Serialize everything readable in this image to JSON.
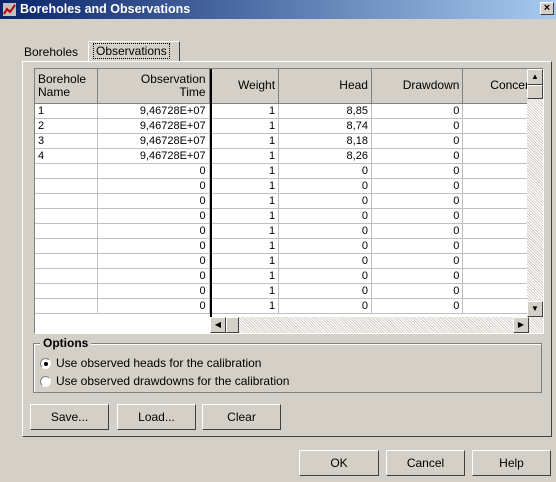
{
  "window": {
    "title": "Boreholes and Observations",
    "close_glyph": "×"
  },
  "tabs": [
    {
      "label": "Boreholes"
    },
    {
      "label": "Observations"
    }
  ],
  "grid": {
    "columns": [
      {
        "line1": "Borehole",
        "line2": "Name"
      },
      {
        "line1": "Observation",
        "line2": "Time"
      },
      {
        "line1": "Weight",
        "line2": ""
      },
      {
        "line1": "Head",
        "line2": ""
      },
      {
        "line1": "Drawdown",
        "line2": ""
      },
      {
        "line1": "Concentr",
        "line2": ""
      }
    ],
    "rows": [
      [
        "1",
        "9,46728E+07",
        "1",
        "8,85",
        "0",
        ""
      ],
      [
        "2",
        "9,46728E+07",
        "1",
        "8,74",
        "0",
        ""
      ],
      [
        "3",
        "9,46728E+07",
        "1",
        "8,18",
        "0",
        ""
      ],
      [
        "4",
        "9,46728E+07",
        "1",
        "8,26",
        "0",
        ""
      ],
      [
        "",
        "0",
        "1",
        "0",
        "0",
        ""
      ],
      [
        "",
        "0",
        "1",
        "0",
        "0",
        ""
      ],
      [
        "",
        "0",
        "1",
        "0",
        "0",
        ""
      ],
      [
        "",
        "0",
        "1",
        "0",
        "0",
        ""
      ],
      [
        "",
        "0",
        "1",
        "0",
        "0",
        ""
      ],
      [
        "",
        "0",
        "1",
        "0",
        "0",
        ""
      ],
      [
        "",
        "0",
        "1",
        "0",
        "0",
        ""
      ],
      [
        "",
        "0",
        "1",
        "0",
        "0",
        ""
      ],
      [
        "",
        "0",
        "1",
        "0",
        "0",
        ""
      ],
      [
        "",
        "0",
        "1",
        "0",
        "0",
        ""
      ]
    ]
  },
  "options": {
    "legend": "Options",
    "heads_label": "Use observed heads for the calibration",
    "drawdowns_label": "Use observed drawdowns for the calibration",
    "selected": "heads"
  },
  "buttons": {
    "save": "Save...",
    "load": "Load...",
    "clear": "Clear",
    "ok": "OK",
    "cancel": "Cancel",
    "help": "Help"
  }
}
